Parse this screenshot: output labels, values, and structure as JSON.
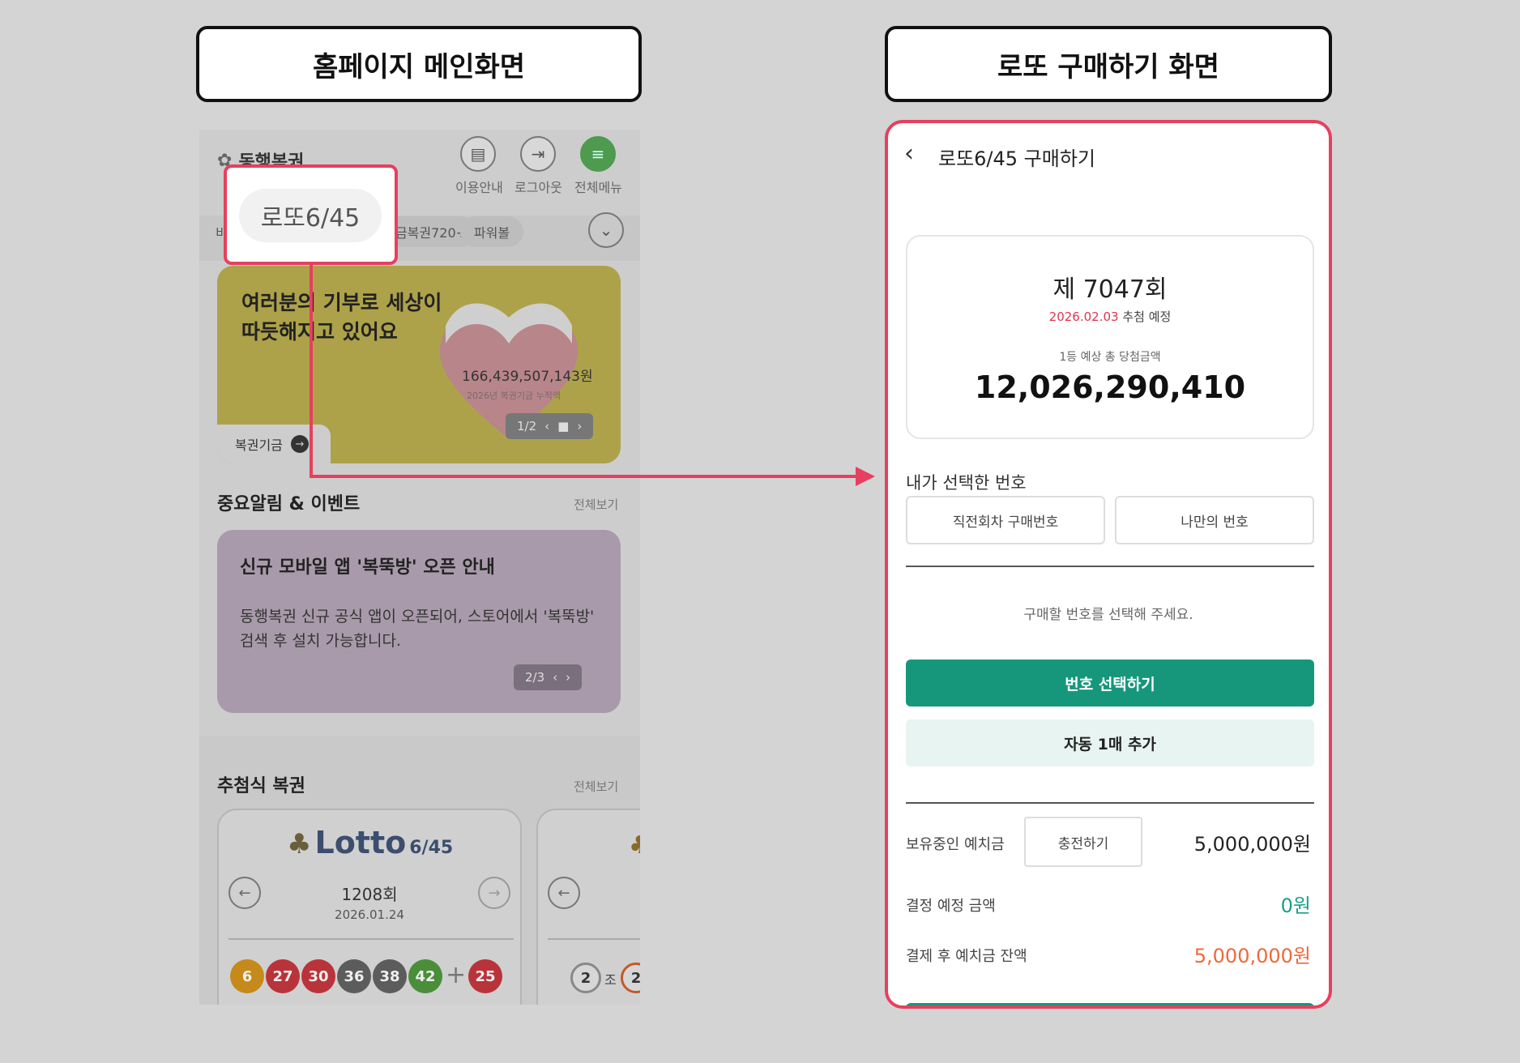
{
  "titles": {
    "left": "홈페이지 메인화면",
    "right": "로또 구매하기 화면"
  },
  "home": {
    "logo": "동행복권",
    "header_buttons": [
      {
        "label": "이용안내",
        "icon": "book-icon"
      },
      {
        "label": "로그아웃",
        "icon": "logout-icon"
      },
      {
        "label": "전체메뉴",
        "icon": "menu-icon"
      }
    ],
    "game_tabs": [
      "비",
      "로또6/45",
      "연금복권720+",
      "파워볼"
    ],
    "game_tab_partial": "금복권720+",
    "highlight_tab": "로또6/45",
    "banner": {
      "line1": "여러분의 기부로 세상이",
      "line2": "따듯해지고 있어요",
      "amount": "166,439,507,143원",
      "amount_sub": "2026년 복권기금 누적액",
      "pager": "1/2",
      "tab_label": "복권기금"
    },
    "events": {
      "title": "중요알림 & 이벤트",
      "see_all": "전체보기",
      "card_title": "신규 모바일 앱 '복뚝방' 오픈 안내",
      "card_body": "동행복권 신규 공식 앱이 오픈되어, 스토어에서 '복뚝방' 검색 후 설치 가능합니다.",
      "pager": "2/3"
    },
    "draw_lottery": {
      "title": "추첨식 복권",
      "see_all": "전체보기",
      "lotto_logo": "Lotto",
      "lotto_logo_sub": "6/45",
      "round": "1208회",
      "date": "2026.01.24",
      "numbers": [
        6,
        27,
        30,
        36,
        38,
        42
      ],
      "bonus": 25,
      "plus": "+",
      "card2_numbers": [
        "2",
        "조",
        "2"
      ],
      "ball_colors": {
        "yellow": "#c58a1a",
        "red": "#b8343a",
        "gray": "#5c5c5c",
        "green": "#4a8e3a"
      }
    }
  },
  "purchase": {
    "header_title": "로또6/45 구매하기",
    "round": "제 7047회",
    "draw_date": "2026.02.03",
    "draw_date_suffix": "추첨 예정",
    "prize_label": "1등 예상 총 당첨금액",
    "prize_amount": "12,026,290,410",
    "selected_label": "내가 선택한 번호",
    "tab_prev": "직전회차 구매번호",
    "tab_mine": "나만의 번호",
    "hint": "구매할 번호를 선택해 주세요.",
    "btn_select": "번호 선택하기",
    "btn_auto": "자동 1매 추가",
    "deposit_label": "보유중인 예치금",
    "charge_label": "충전하기",
    "deposit_value": "5,000,000원",
    "pay_label": "결정 예정 금액",
    "pay_value": "0원",
    "after_label": "결제 후 예치금 잔액",
    "after_value": "5,000,000원",
    "colors": {
      "accent": "#16977b",
      "highlight": "#e6405e",
      "pay": "#19a08a",
      "after": "#f0683a"
    }
  }
}
